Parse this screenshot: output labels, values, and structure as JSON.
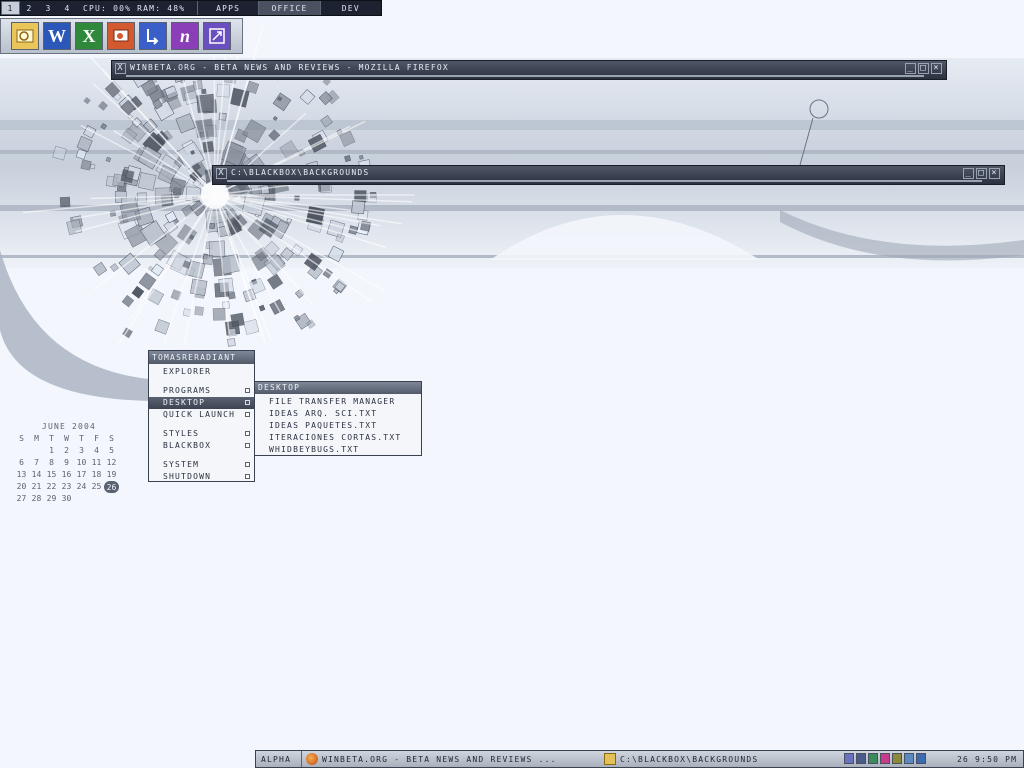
{
  "toolbar": {
    "workspaces": [
      "1",
      "2",
      "3",
      "4"
    ],
    "active_workspace": "1",
    "stats": "CPU: 00% RAM: 48%",
    "buttons": [
      {
        "label": "APPS",
        "active": false
      },
      {
        "label": "OFFICE",
        "active": true
      },
      {
        "label": "DEV",
        "active": false
      }
    ]
  },
  "launcher": {
    "icons": [
      "outlook-icon",
      "word-icon",
      "excel-icon",
      "powerpoint-icon",
      "visio-icon",
      "onenote-icon",
      "infopath-icon"
    ]
  },
  "windows": [
    {
      "title": "WINBETA.ORG - BETA NEWS AND REVIEWS - MOZILLA FIREFOX"
    },
    {
      "title": "C:\\BLACKBOX\\BACKGROUNDS"
    }
  ],
  "root_menu": {
    "title": "TOMASRERADIANT",
    "items": [
      {
        "label": "EXPLORER",
        "submenu": false,
        "selected": false
      },
      {
        "label": "PROGRAMS",
        "submenu": true,
        "selected": false
      },
      {
        "label": "DESKTOP",
        "submenu": true,
        "selected": true
      },
      {
        "label": "QUICK LAUNCH",
        "submenu": true,
        "selected": false
      },
      {
        "label": "STYLES",
        "submenu": true,
        "selected": false
      },
      {
        "label": "BLACKBOX",
        "submenu": true,
        "selected": false
      },
      {
        "label": "SYSTEM",
        "submenu": true,
        "selected": false
      },
      {
        "label": "SHUTDOWN",
        "submenu": true,
        "selected": false
      }
    ]
  },
  "desktop_submenu": {
    "title": "DESKTOP",
    "items": [
      "FILE TRANSFER MANAGER",
      "IDEAS ARQ. SCI.TXT",
      "IDEAS PAQUETES.TXT",
      "ITERACIONES CORTAS.TXT",
      "WHIDBEYBUGS.TXT"
    ]
  },
  "calendar": {
    "title": "JUNE 2004",
    "weekdays": [
      "S",
      "M",
      "T",
      "W",
      "T",
      "F",
      "S"
    ],
    "weeks": [
      [
        "",
        "",
        "",
        "",
        "",
        "",
        ""
      ],
      [
        "",
        "",
        "1",
        "2",
        "3",
        "4",
        "5"
      ],
      [
        "6",
        "7",
        "8",
        "9",
        "10",
        "11",
        "12"
      ],
      [
        "13",
        "14",
        "15",
        "16",
        "17",
        "18",
        "19"
      ],
      [
        "20",
        "21",
        "22",
        "23",
        "24",
        "25",
        "26"
      ],
      [
        "27",
        "28",
        "29",
        "30",
        "",
        "",
        ""
      ]
    ],
    "today": "26"
  },
  "taskbar": {
    "workspace": "ALPHA",
    "tasks": [
      {
        "label": "WINBETA.ORG - BETA NEWS AND REVIEWS ...",
        "icon": "firefox-icon"
      },
      {
        "label": "C:\\BLACKBOX\\BACKGROUNDS",
        "icon": "folder-icon"
      }
    ],
    "clock": "26 9:50 PM"
  },
  "colors": {
    "background": "#f3f6fc",
    "chrome_dark": "#2c3140",
    "accent": "#5a6272"
  }
}
